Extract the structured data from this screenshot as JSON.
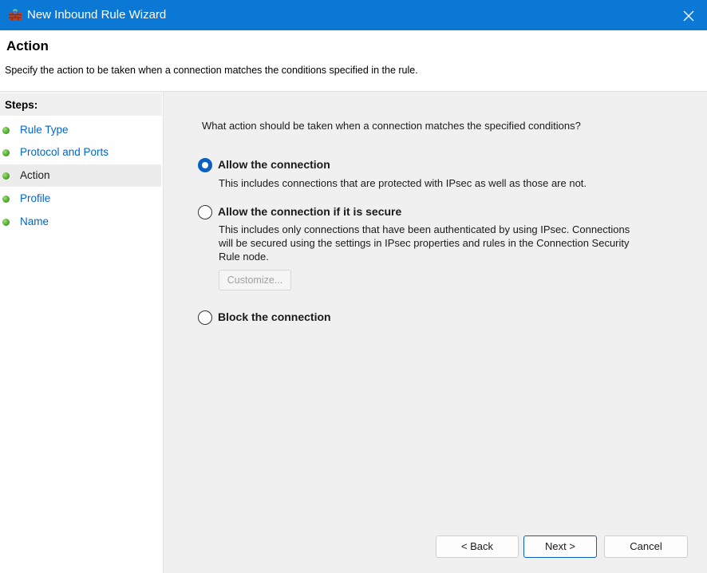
{
  "window": {
    "title": "New Inbound Rule Wizard",
    "icon": "firewall-brick-icon",
    "close_icon": "close-icon"
  },
  "header": {
    "title": "Action",
    "description": "Specify the action to be taken when a connection matches the conditions specified in the rule."
  },
  "steps": {
    "title": "Steps:",
    "items": [
      {
        "label": "Rule Type",
        "active": false
      },
      {
        "label": "Protocol and Ports",
        "active": false
      },
      {
        "label": "Action",
        "active": true
      },
      {
        "label": "Profile",
        "active": false
      },
      {
        "label": "Name",
        "active": false
      }
    ]
  },
  "content": {
    "question": "What action should be taken when a connection matches the specified conditions?",
    "options": [
      {
        "label": "Allow the connection",
        "description": "This includes connections that are protected with IPsec as well as those are not.",
        "selected": true
      },
      {
        "label": "Allow the connection if it is secure",
        "description_lines": [
          "This includes only connections that have been authenticated by using IPsec.  Connections",
          "will be secured using the settings in IPsec properties and rules in the Connection Security",
          "Rule node."
        ],
        "selected": false,
        "customize_label": "Customize..."
      },
      {
        "label": "Block the connection",
        "selected": false
      }
    ]
  },
  "buttons": {
    "back": "< Back",
    "next": "Next >",
    "cancel": "Cancel"
  },
  "colors": {
    "titlebar": "#0a78d4",
    "link": "#0066cc",
    "radio_selected": "#0a5fc5",
    "step_dot": "#3e9f1c"
  }
}
